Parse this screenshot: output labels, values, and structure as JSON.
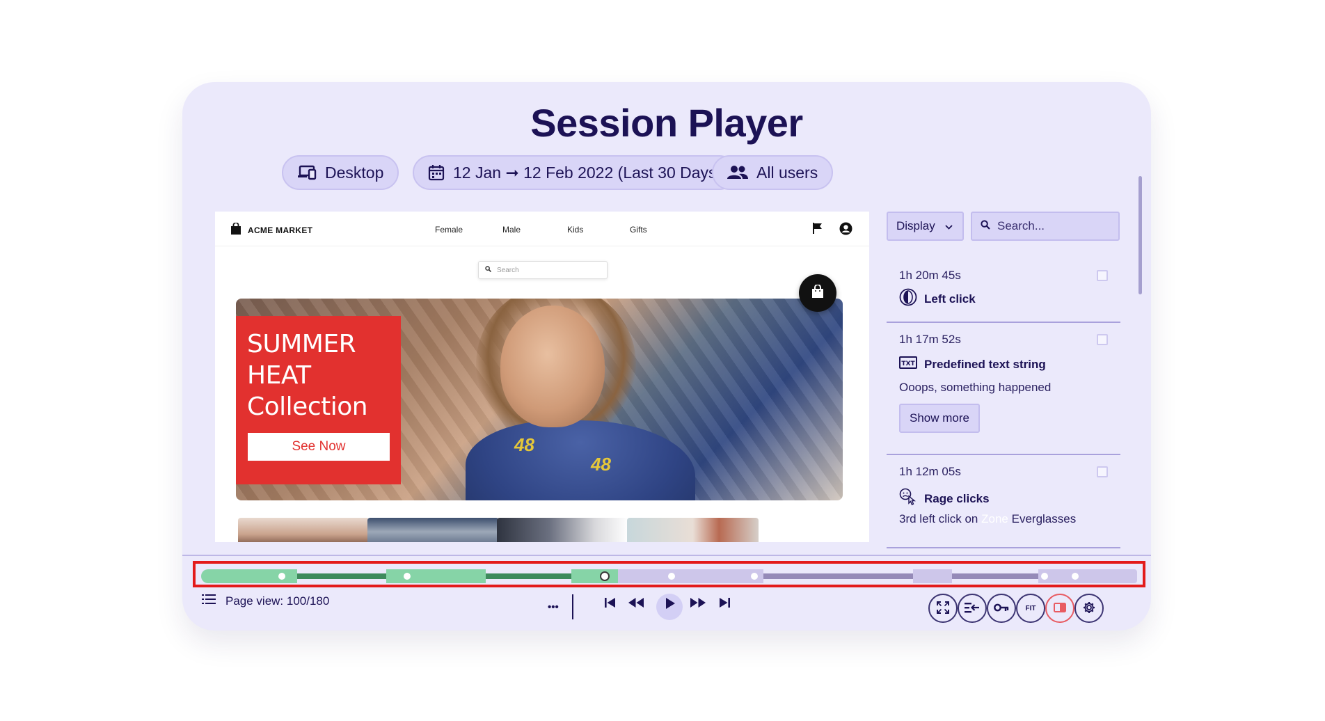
{
  "header": {
    "title": "Session Player"
  },
  "filters": {
    "device": "Desktop",
    "date_range": "12 Jan ➞ 12 Feb 2022 (Last 30 Days)",
    "audience": "All users"
  },
  "site": {
    "logo_text": "ACME MARKET",
    "nav": [
      "Female",
      "Male",
      "Kids",
      "Gifts"
    ],
    "search_placeholder": "Search",
    "promo": {
      "line1": "SUMMER",
      "line2": "HEAT",
      "line3": "Collection",
      "cta": "See Now"
    },
    "shirt_number": "48"
  },
  "events_panel": {
    "display_label": "Display",
    "search_placeholder": "Search...",
    "show_more_label": "Show more",
    "events": [
      {
        "time": "1h 20m 45s",
        "type": "Left click",
        "icon": "left-click-icon"
      },
      {
        "time": "1h 17m 52s",
        "type": "Predefined text string",
        "icon": "text-string-icon",
        "description": "Ooops, something happened"
      },
      {
        "time": "1h 12m 05s",
        "type": "Rage clicks",
        "icon": "rage-click-icon",
        "description_prefix": "3rd left click on",
        "description_zone": "Zone",
        "description_suffix": "Everglasses"
      }
    ]
  },
  "player": {
    "page_view": "Page view: 100/180",
    "more_label": "•••",
    "fit_label": "FIT",
    "colors": {
      "visited_light": "#86d4a7",
      "visited_dark": "#3e8a5d",
      "upcoming_light": "#cdc6ea",
      "upcoming_dark": "#958ab8",
      "highlight": "#e31b1b"
    }
  }
}
